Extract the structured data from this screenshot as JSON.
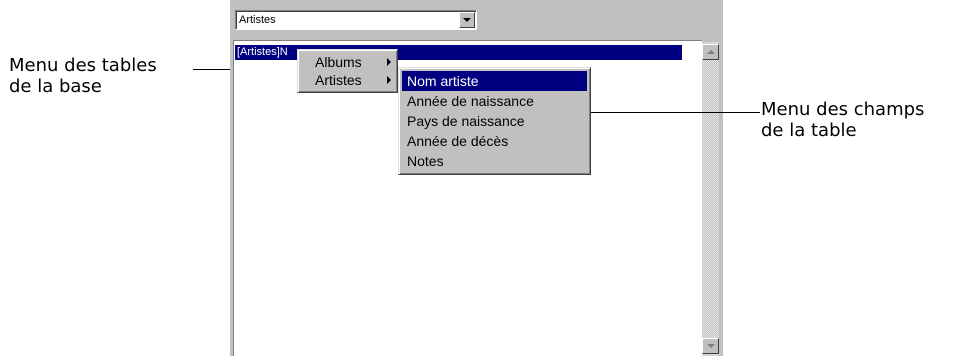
{
  "callouts": {
    "left": [
      "Menu des tables",
      "de la base"
    ],
    "right": [
      "Menu des champs",
      "de la table"
    ]
  },
  "table_selector": {
    "value": "Artistes"
  },
  "list": {
    "selected_row": "[Artistes]N"
  },
  "tables_menu": {
    "items": [
      {
        "label": "Albums",
        "has_submenu": true,
        "highlighted": false
      },
      {
        "label": "Artistes",
        "has_submenu": true,
        "highlighted": false
      }
    ]
  },
  "fields_menu": {
    "items": [
      {
        "label": "Nom artiste",
        "highlighted": true
      },
      {
        "label": "Année de naissance",
        "highlighted": false
      },
      {
        "label": "Pays de naissance",
        "highlighted": false
      },
      {
        "label": "Année de décès",
        "highlighted": false
      },
      {
        "label": "Notes",
        "highlighted": false
      }
    ]
  },
  "colors": {
    "selection": "#000080",
    "window": "#c0c0c0"
  }
}
